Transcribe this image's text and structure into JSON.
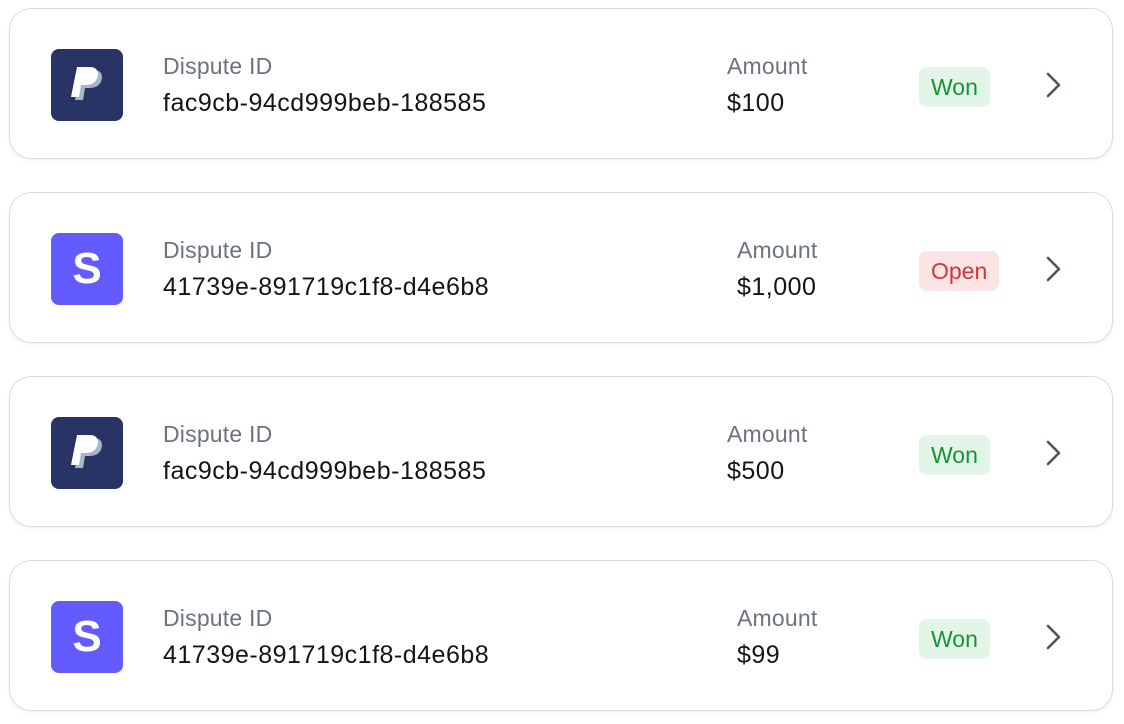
{
  "disputes": [
    {
      "provider": "PayPal",
      "logo_icon": "paypal-logo-icon",
      "id_label": "Dispute ID",
      "id": "fac9cb-94cd999beb-188585",
      "amount_label": "Amount",
      "amount": "$100",
      "status": "Won"
    },
    {
      "provider": "Stripe",
      "logo_icon": "stripe-logo-icon",
      "id_label": "Dispute ID",
      "id": "41739e-891719c1f8-d4e6b8",
      "amount_label": "Amount",
      "amount": "$1,000",
      "status": "Open"
    },
    {
      "provider": "PayPal",
      "logo_icon": "paypal-logo-icon",
      "id_label": "Dispute ID",
      "id": "fac9cb-94cd999beb-188585",
      "amount_label": "Amount",
      "amount": "$500",
      "status": "Won"
    },
    {
      "provider": "Stripe",
      "logo_icon": "stripe-logo-icon",
      "id_label": "Dispute ID",
      "id": "41739e-891719c1f8-d4e6b8",
      "amount_label": "Amount",
      "amount": "$99",
      "status": "Won"
    }
  ],
  "colors": {
    "paypal_bg": "#283366",
    "stripe_bg": "#635bff",
    "won_bg": "#e3f5e7",
    "won_text": "#17923a",
    "open_bg": "#fde3e3",
    "open_text": "#d1363a"
  }
}
